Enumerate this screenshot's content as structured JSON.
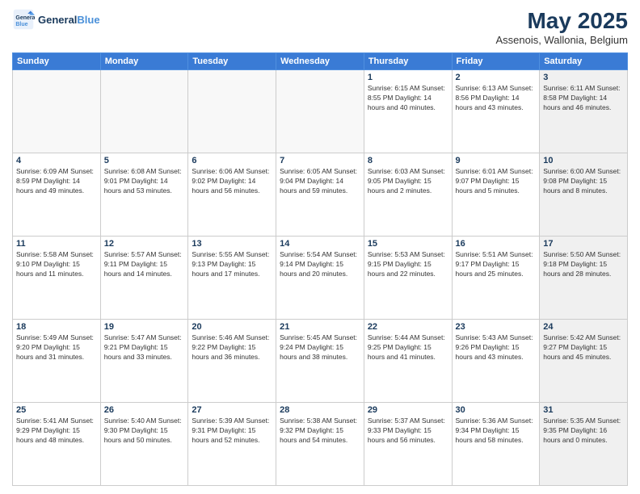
{
  "header": {
    "logo_line1": "General",
    "logo_line2": "Blue",
    "title": "May 2025",
    "subtitle": "Assenois, Wallonia, Belgium"
  },
  "weekdays": [
    "Sunday",
    "Monday",
    "Tuesday",
    "Wednesday",
    "Thursday",
    "Friday",
    "Saturday"
  ],
  "weeks": [
    [
      {
        "day": "",
        "empty": true
      },
      {
        "day": "",
        "empty": true
      },
      {
        "day": "",
        "empty": true
      },
      {
        "day": "",
        "empty": true
      },
      {
        "day": "1",
        "info": "Sunrise: 6:15 AM\nSunset: 8:55 PM\nDaylight: 14 hours\nand 40 minutes."
      },
      {
        "day": "2",
        "info": "Sunrise: 6:13 AM\nSunset: 8:56 PM\nDaylight: 14 hours\nand 43 minutes."
      },
      {
        "day": "3",
        "shaded": true,
        "info": "Sunrise: 6:11 AM\nSunset: 8:58 PM\nDaylight: 14 hours\nand 46 minutes."
      }
    ],
    [
      {
        "day": "4",
        "info": "Sunrise: 6:09 AM\nSunset: 8:59 PM\nDaylight: 14 hours\nand 49 minutes."
      },
      {
        "day": "5",
        "info": "Sunrise: 6:08 AM\nSunset: 9:01 PM\nDaylight: 14 hours\nand 53 minutes."
      },
      {
        "day": "6",
        "info": "Sunrise: 6:06 AM\nSunset: 9:02 PM\nDaylight: 14 hours\nand 56 minutes."
      },
      {
        "day": "7",
        "info": "Sunrise: 6:05 AM\nSunset: 9:04 PM\nDaylight: 14 hours\nand 59 minutes."
      },
      {
        "day": "8",
        "info": "Sunrise: 6:03 AM\nSunset: 9:05 PM\nDaylight: 15 hours\nand 2 minutes."
      },
      {
        "day": "9",
        "info": "Sunrise: 6:01 AM\nSunset: 9:07 PM\nDaylight: 15 hours\nand 5 minutes."
      },
      {
        "day": "10",
        "shaded": true,
        "info": "Sunrise: 6:00 AM\nSunset: 9:08 PM\nDaylight: 15 hours\nand 8 minutes."
      }
    ],
    [
      {
        "day": "11",
        "info": "Sunrise: 5:58 AM\nSunset: 9:10 PM\nDaylight: 15 hours\nand 11 minutes."
      },
      {
        "day": "12",
        "info": "Sunrise: 5:57 AM\nSunset: 9:11 PM\nDaylight: 15 hours\nand 14 minutes."
      },
      {
        "day": "13",
        "info": "Sunrise: 5:55 AM\nSunset: 9:13 PM\nDaylight: 15 hours\nand 17 minutes."
      },
      {
        "day": "14",
        "info": "Sunrise: 5:54 AM\nSunset: 9:14 PM\nDaylight: 15 hours\nand 20 minutes."
      },
      {
        "day": "15",
        "info": "Sunrise: 5:53 AM\nSunset: 9:15 PM\nDaylight: 15 hours\nand 22 minutes."
      },
      {
        "day": "16",
        "info": "Sunrise: 5:51 AM\nSunset: 9:17 PM\nDaylight: 15 hours\nand 25 minutes."
      },
      {
        "day": "17",
        "shaded": true,
        "info": "Sunrise: 5:50 AM\nSunset: 9:18 PM\nDaylight: 15 hours\nand 28 minutes."
      }
    ],
    [
      {
        "day": "18",
        "info": "Sunrise: 5:49 AM\nSunset: 9:20 PM\nDaylight: 15 hours\nand 31 minutes."
      },
      {
        "day": "19",
        "info": "Sunrise: 5:47 AM\nSunset: 9:21 PM\nDaylight: 15 hours\nand 33 minutes."
      },
      {
        "day": "20",
        "info": "Sunrise: 5:46 AM\nSunset: 9:22 PM\nDaylight: 15 hours\nand 36 minutes."
      },
      {
        "day": "21",
        "info": "Sunrise: 5:45 AM\nSunset: 9:24 PM\nDaylight: 15 hours\nand 38 minutes."
      },
      {
        "day": "22",
        "info": "Sunrise: 5:44 AM\nSunset: 9:25 PM\nDaylight: 15 hours\nand 41 minutes."
      },
      {
        "day": "23",
        "info": "Sunrise: 5:43 AM\nSunset: 9:26 PM\nDaylight: 15 hours\nand 43 minutes."
      },
      {
        "day": "24",
        "shaded": true,
        "info": "Sunrise: 5:42 AM\nSunset: 9:27 PM\nDaylight: 15 hours\nand 45 minutes."
      }
    ],
    [
      {
        "day": "25",
        "info": "Sunrise: 5:41 AM\nSunset: 9:29 PM\nDaylight: 15 hours\nand 48 minutes."
      },
      {
        "day": "26",
        "info": "Sunrise: 5:40 AM\nSunset: 9:30 PM\nDaylight: 15 hours\nand 50 minutes."
      },
      {
        "day": "27",
        "info": "Sunrise: 5:39 AM\nSunset: 9:31 PM\nDaylight: 15 hours\nand 52 minutes."
      },
      {
        "day": "28",
        "info": "Sunrise: 5:38 AM\nSunset: 9:32 PM\nDaylight: 15 hours\nand 54 minutes."
      },
      {
        "day": "29",
        "info": "Sunrise: 5:37 AM\nSunset: 9:33 PM\nDaylight: 15 hours\nand 56 minutes."
      },
      {
        "day": "30",
        "info": "Sunrise: 5:36 AM\nSunset: 9:34 PM\nDaylight: 15 hours\nand 58 minutes."
      },
      {
        "day": "31",
        "shaded": true,
        "info": "Sunrise: 5:35 AM\nSunset: 9:35 PM\nDaylight: 16 hours\nand 0 minutes."
      }
    ]
  ]
}
